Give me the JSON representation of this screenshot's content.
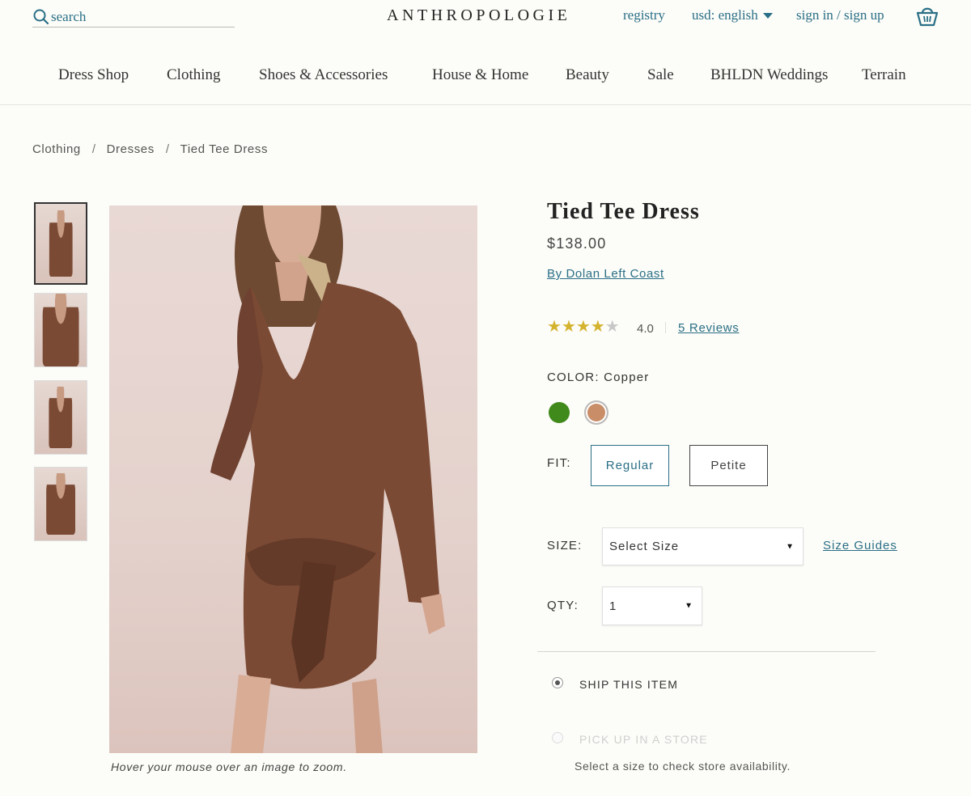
{
  "header": {
    "search_placeholder": "search",
    "brand": "ANTHROPOLOGIE",
    "registry": "registry",
    "currency": "usd: english",
    "sign_in": "sign in / sign up"
  },
  "nav": {
    "items": [
      "Dress Shop",
      "Clothing",
      "Shoes & Accessories",
      "House & Home",
      "Beauty",
      "Sale",
      "BHLDN Weddings",
      "Terrain"
    ]
  },
  "breadcrumb": {
    "items": [
      "Clothing",
      "Dresses",
      "Tied Tee Dress"
    ],
    "separator": "/"
  },
  "gallery": {
    "zoom_hint": "Hover your mouse over an image to zoom."
  },
  "product": {
    "title": "Tied Tee Dress",
    "price": "$138.00",
    "brand_link": "By Dolan Left Coast",
    "rating": {
      "stars_filled": 4,
      "stars_total": 5,
      "value": "4.0",
      "reviews_link": "5 Reviews"
    },
    "color": {
      "label": "COLOR:",
      "selected": "Copper",
      "swatches": [
        {
          "name": "green",
          "hex": "#3f8a1a"
        },
        {
          "name": "copper",
          "hex": "#c98d68"
        }
      ]
    },
    "fit": {
      "label": "FIT:",
      "options": [
        "Regular",
        "Petite"
      ],
      "selected": "Regular"
    },
    "size": {
      "label": "SIZE:",
      "value": "Select Size",
      "guide_link": "Size Guides"
    },
    "qty": {
      "label": "QTY:",
      "value": "1"
    },
    "fulfillment": {
      "ship": "SHIP THIS ITEM",
      "pickup": "PICK UP IN A STORE",
      "store_note": "Select a size to check store availability."
    }
  },
  "colors": {
    "accent": "#2a6f86",
    "star": "#d4b32e",
    "dress": "#7b4a34"
  }
}
